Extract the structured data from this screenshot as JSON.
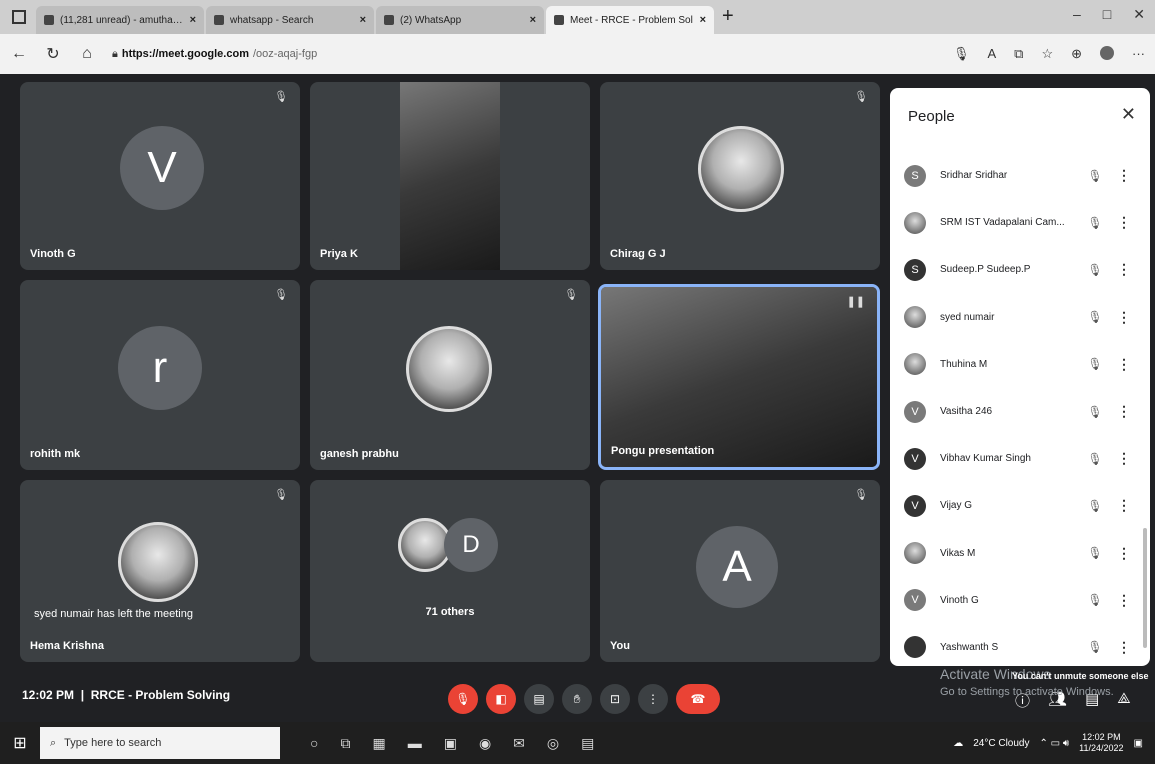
{
  "browser": {
    "tabs": [
      {
        "label": "(11,281 unread) - amuthaiaj@",
        "active": false
      },
      {
        "label": "whatsapp - Search",
        "active": false
      },
      {
        "label": "(2) WhatsApp",
        "active": false
      },
      {
        "label": "Meet - RRCE - Problem Sol",
        "active": true
      }
    ],
    "url_domain": "https://meet.google.com",
    "url_path": "/ooz-aqaj-fgp"
  },
  "tiles": [
    {
      "name": "Vinoth G",
      "initial": "V"
    },
    {
      "name": "Priya K"
    },
    {
      "name": "Chirag G J"
    },
    {
      "name": "rohith mk",
      "initial": "r"
    },
    {
      "name": "ganesh prabhu"
    },
    {
      "name": "Pongu presentation"
    },
    {
      "name": "Hema Krishna",
      "message": "syed numair has left the meeting"
    },
    {
      "others_label": "71 others",
      "initial": "D"
    },
    {
      "name": "You",
      "initial": "A"
    }
  ],
  "people_panel": {
    "title": "People",
    "participants": [
      {
        "name": "Sridhar Sridhar",
        "initial": "S",
        "style": "gray"
      },
      {
        "name": "SRM IST Vadapalani Cam...",
        "initial": "",
        "style": "photo"
      },
      {
        "name": "Sudeep.P Sudeep.P",
        "initial": "S",
        "style": "dark"
      },
      {
        "name": "syed numair",
        "initial": "",
        "style": "photo"
      },
      {
        "name": "Thuhina M",
        "initial": "",
        "style": "photo"
      },
      {
        "name": "Vasitha 246",
        "initial": "V",
        "style": "gray"
      },
      {
        "name": "Vibhav Kumar Singh",
        "initial": "V",
        "style": "dark"
      },
      {
        "name": "Vijay G",
        "initial": "V",
        "style": "dark"
      },
      {
        "name": "Vikas M",
        "initial": "",
        "style": "photo"
      },
      {
        "name": "Vinoth G",
        "initial": "V",
        "style": "gray"
      },
      {
        "name": "Yashwanth S",
        "initial": "",
        "style": "dark"
      }
    ]
  },
  "windows_watermark": {
    "line1": "Activate Windows",
    "line2": "Go to Settings to activate Windows."
  },
  "tooltip": "You can't unmute someone else",
  "meeting": {
    "time": "12:02 PM",
    "title": "RRCE - Problem Solving"
  },
  "taskbar": {
    "search_placeholder": "Type here to search",
    "weather": "24°C Cloudy",
    "time": "12:02 PM",
    "date": "11/24/2022"
  }
}
